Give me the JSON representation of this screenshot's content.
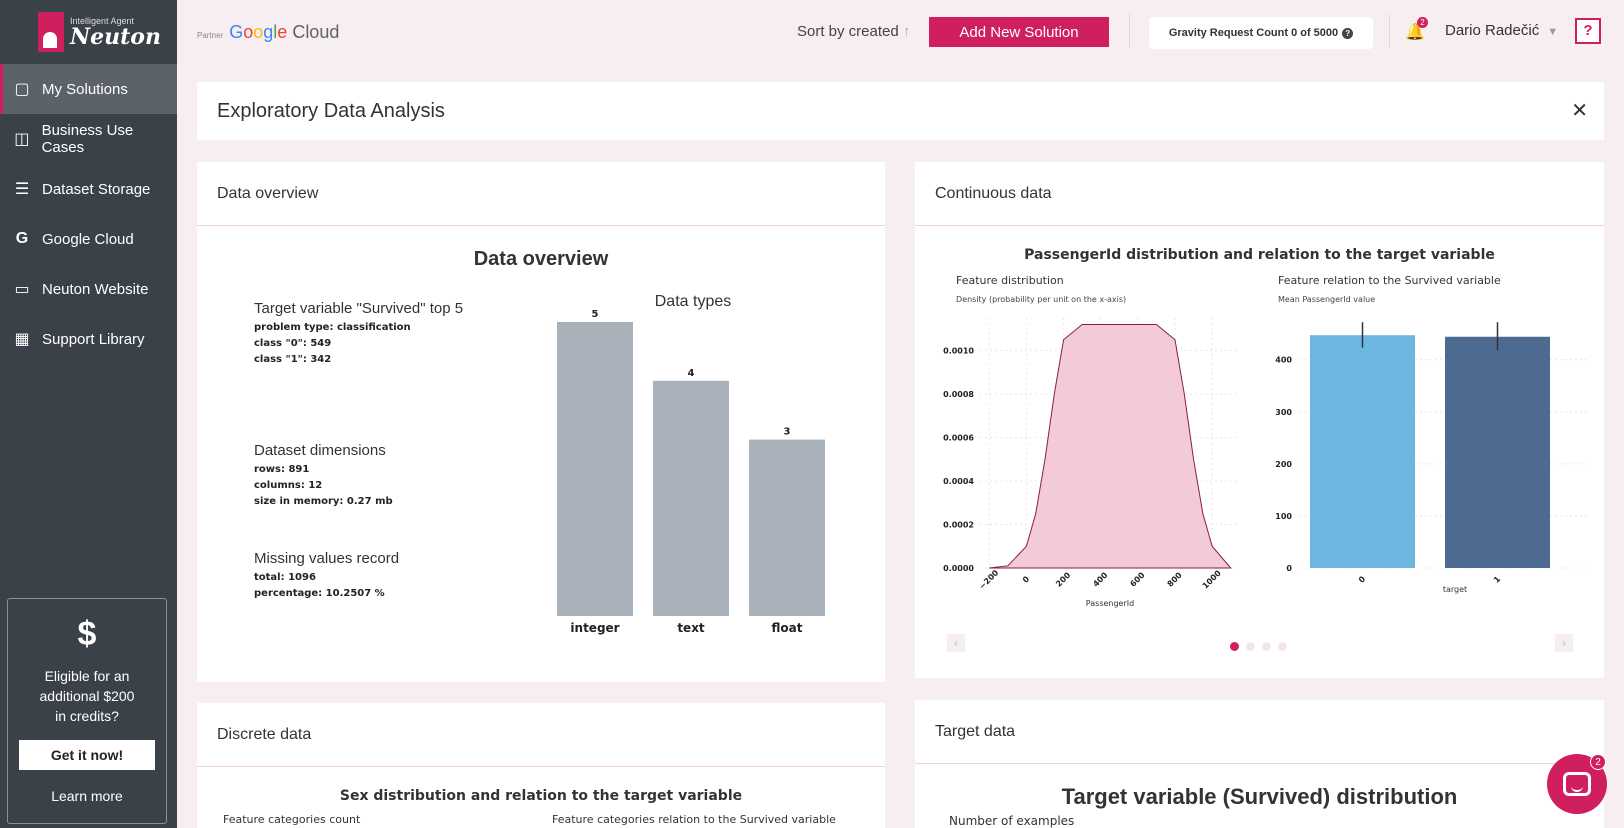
{
  "sidebar": {
    "logo_small": "Intelligent Agent",
    "logo_big": "Neuton",
    "items": [
      {
        "label": "My Solutions",
        "icon": "cube-icon",
        "active": true
      },
      {
        "label": "Business Use Cases",
        "icon": "briefcase-icon"
      },
      {
        "label": "Dataset Storage",
        "icon": "layers-icon"
      },
      {
        "label": "Google Cloud",
        "icon": "google-icon"
      },
      {
        "label": "Neuton Website",
        "icon": "monitor-icon"
      },
      {
        "label": "Support Library",
        "icon": "book-icon"
      }
    ],
    "promo": {
      "symbol": "$",
      "text_line1": "Eligible for an",
      "text_line2": "additional $200",
      "text_line3": "in credits?",
      "button": "Get it now!",
      "link": "Learn more"
    }
  },
  "topbar": {
    "partner_label": "Partner",
    "partner_brand": "Google Cloud",
    "sort_label": "Sort by created",
    "add_button": "Add New Solution",
    "gravity_text": "Gravity Request Count 0 of 5000",
    "notification_count": "2",
    "user_name": "Dario Radečić",
    "help_label": "?"
  },
  "page": {
    "title": "Exploratory Data Analysis",
    "close": "✕"
  },
  "data_overview": {
    "card_title": "Data overview",
    "heading": "Data overview",
    "target": {
      "title": "Target variable \"Survived\" top 5",
      "lines": [
        "problem type: classification",
        "class \"0\": 549",
        "class \"1\": 342"
      ]
    },
    "dimensions": {
      "title": "Dataset dimensions",
      "lines": [
        "rows: 891",
        "columns: 12",
        "size in memory: 0.27 mb"
      ]
    },
    "missing": {
      "title": "Missing values record",
      "lines": [
        "total: 1096",
        "percentage: 10.2507 %"
      ]
    }
  },
  "continuous": {
    "card_title": "Continuous data",
    "chart_title": "PassengerId distribution and relation to the target variable",
    "left_sub": "Feature distribution",
    "left_ylabel": "Density (probability per unit on the x-axis)",
    "left_xlabel": "PassengerId",
    "right_sub": "Feature relation to the Survived variable",
    "right_ylabel": "Mean PassengerId value",
    "right_xlabel": "target",
    "prev": "‹",
    "next": "›"
  },
  "discrete": {
    "card_title": "Discrete data",
    "chart_title": "Sex distribution and relation to the target variable",
    "left_sub": "Feature categories count",
    "right_sub": "Feature categories relation to the Survived variable"
  },
  "target_data": {
    "card_title": "Target data",
    "heading": "Target variable (Survived) distribution",
    "sub": "Number of examples"
  },
  "chat": {
    "badge": "2"
  },
  "colors": {
    "accent": "#d01f5e",
    "sidebar": "#3a4148",
    "bar_gray": "#a8b1b9",
    "kde_fill": "#f2cad8",
    "bar_blue_light": "#6db6df",
    "bar_blue_dark": "#4d6b91"
  },
  "chart_data": [
    {
      "type": "bar",
      "title": "Data types",
      "categories": [
        "integer",
        "text",
        "float"
      ],
      "values": [
        5,
        4,
        3
      ],
      "ylim": [
        0,
        5
      ]
    },
    {
      "type": "area",
      "title": "Feature distribution",
      "xlabel": "PassengerId",
      "ylabel": "Density (probability per unit on the x-axis)",
      "x": [
        -200,
        -100,
        0,
        50,
        100,
        150,
        200,
        300,
        400,
        500,
        600,
        700,
        800,
        850,
        900,
        950,
        1000,
        1100
      ],
      "values": [
        0.0,
        1e-05,
        0.0001,
        0.00025,
        0.0005,
        0.0008,
        0.00105,
        0.00112,
        0.00112,
        0.00112,
        0.00112,
        0.00112,
        0.00105,
        0.0008,
        0.0005,
        0.00025,
        0.0001,
        0.0
      ],
      "xticks": [
        -200,
        0,
        200,
        400,
        600,
        800,
        1000
      ],
      "yticks": [
        0.0,
        0.0002,
        0.0004,
        0.0006,
        0.0008,
        0.001
      ],
      "xlim": [
        -250,
        1150
      ],
      "ylim": [
        0,
        0.00115
      ]
    },
    {
      "type": "bar",
      "title": "Feature relation to the Survived variable",
      "xlabel": "target",
      "ylabel": "Mean PassengerId value",
      "categories": [
        "0",
        "1"
      ],
      "values": [
        447,
        444
      ],
      "error_low": [
        423,
        418
      ],
      "error_high": [
        472,
        472
      ],
      "yticks": [
        0,
        100,
        200,
        300,
        400
      ],
      "ylim": [
        0,
        480
      ]
    }
  ]
}
